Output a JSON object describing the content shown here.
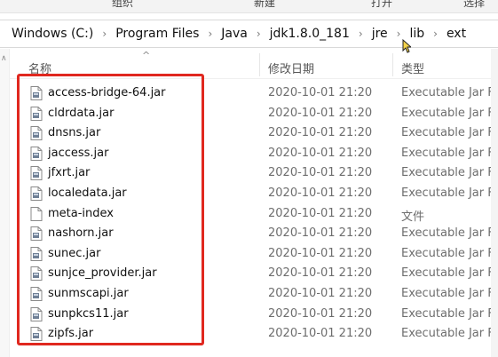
{
  "ribbon": {
    "labels": [
      "组织",
      "新建",
      "打开",
      "选择"
    ]
  },
  "address_bar": {
    "crumbs": [
      "Windows (C:)",
      "Program Files",
      "Java",
      "jdk1.8.0_181",
      "jre",
      "lib",
      "ext"
    ],
    "separator": "›"
  },
  "columns": {
    "name": "名称",
    "date_modified": "修改日期",
    "type": "类型"
  },
  "files": [
    {
      "name": "access-bridge-64.jar",
      "date": "2020-10-01 21:20",
      "type": "Executable Jar Fi",
      "icon": "jar-file-icon"
    },
    {
      "name": "cldrdata.jar",
      "date": "2020-10-01 21:20",
      "type": "Executable Jar Fi",
      "icon": "jar-file-icon"
    },
    {
      "name": "dnsns.jar",
      "date": "2020-10-01 21:20",
      "type": "Executable Jar Fi",
      "icon": "jar-file-icon"
    },
    {
      "name": "jaccess.jar",
      "date": "2020-10-01 21:20",
      "type": "Executable Jar Fi",
      "icon": "jar-file-icon"
    },
    {
      "name": "jfxrt.jar",
      "date": "2020-10-01 21:20",
      "type": "Executable Jar Fi",
      "icon": "jar-file-icon"
    },
    {
      "name": "localedata.jar",
      "date": "2020-10-01 21:20",
      "type": "Executable Jar Fi",
      "icon": "jar-file-icon"
    },
    {
      "name": "meta-index",
      "date": "2020-10-01 21:20",
      "type": "文件",
      "icon": "blank-file-icon"
    },
    {
      "name": "nashorn.jar",
      "date": "2020-10-01 21:20",
      "type": "Executable Jar Fi",
      "icon": "jar-file-icon"
    },
    {
      "name": "sunec.jar",
      "date": "2020-10-01 21:20",
      "type": "Executable Jar Fi",
      "icon": "jar-file-icon"
    },
    {
      "name": "sunjce_provider.jar",
      "date": "2020-10-01 21:20",
      "type": "Executable Jar Fi",
      "icon": "jar-file-icon"
    },
    {
      "name": "sunmscapi.jar",
      "date": "2020-10-01 21:20",
      "type": "Executable Jar Fi",
      "icon": "jar-file-icon"
    },
    {
      "name": "sunpkcs11.jar",
      "date": "2020-10-01 21:20",
      "type": "Executable Jar Fi",
      "icon": "jar-file-icon"
    },
    {
      "name": "zipfs.jar",
      "date": "2020-10-01 21:20",
      "type": "Executable Jar Fi",
      "icon": "jar-file-icon"
    }
  ],
  "colors": {
    "highlight_border": "#e0281f",
    "secondary_text": "#6d6d6d"
  }
}
